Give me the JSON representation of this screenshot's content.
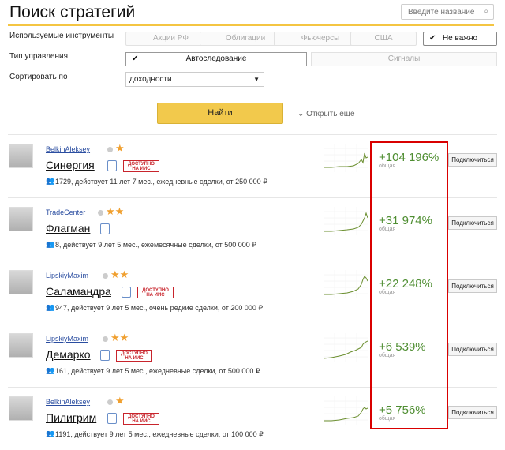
{
  "header": {
    "title": "Поиск стратегий",
    "search_placeholder": "Введите название"
  },
  "filters": {
    "instruments_label": "Используемые инструменты",
    "instruments": [
      {
        "label": "Акции РФ",
        "selected": false
      },
      {
        "label": "Облигации",
        "selected": false
      },
      {
        "label": "Фьючерсы",
        "selected": false
      },
      {
        "label": "США",
        "selected": false
      },
      {
        "label": "Не важно",
        "selected": true
      }
    ],
    "management_label": "Тип управления",
    "management": [
      {
        "label": "Автоследование",
        "selected": true
      },
      {
        "label": "Сигналы",
        "selected": false
      }
    ],
    "sort_label": "Сортировать по",
    "sort_value": "доходности",
    "find_button": "Найти",
    "more_link": "Открыть ещё"
  },
  "strategies": [
    {
      "author": "BelkinAleksey",
      "stars": 1,
      "name": "Синергия",
      "iis": true,
      "meta": "1729, действует 11 лет 7 мес., ежедневные сделки, от 250 000 ₽",
      "return": "+104 196%",
      "return_label": "общая",
      "button": "Подключиться"
    },
    {
      "author": "TradeCenter",
      "stars": 2,
      "name": "Флагман",
      "iis": false,
      "meta": "8, действует 9 лет 5 мес., ежемесячные сделки, от 500 000 ₽",
      "return": "+31 974%",
      "return_label": "общая",
      "button": "Подключиться"
    },
    {
      "author": "LipskiyMaxim",
      "stars": 2,
      "name": "Саламандра",
      "iis": true,
      "meta": "947, действует 9 лет 5 мес., очень редкие сделки, от 200 000 ₽",
      "return": "+22 248%",
      "return_label": "общая",
      "button": "Подключиться"
    },
    {
      "author": "LipskiyMaxim",
      "stars": 2,
      "name": "Демарко",
      "iis": true,
      "meta": "161, действует 9 лет 5 мес., ежедневные сделки, от 500 000 ₽",
      "return": "+6 539%",
      "return_label": "общая",
      "button": "Подключиться"
    },
    {
      "author": "BelkinAleksey",
      "stars": 1,
      "name": "Пилигрим",
      "iis": true,
      "meta": "1191, действует 9 лет 5 мес., ежедневные сделки, от 100 000 ₽",
      "return": "+5 756%",
      "return_label": "общая",
      "button": "Подключиться"
    }
  ],
  "badge_iis": "ДОСТУПНО НА ИИС",
  "colors": {
    "accent": "#f2c94c",
    "positive": "#4f8e32",
    "highlight": "#d90000",
    "link": "#2a4da0"
  }
}
